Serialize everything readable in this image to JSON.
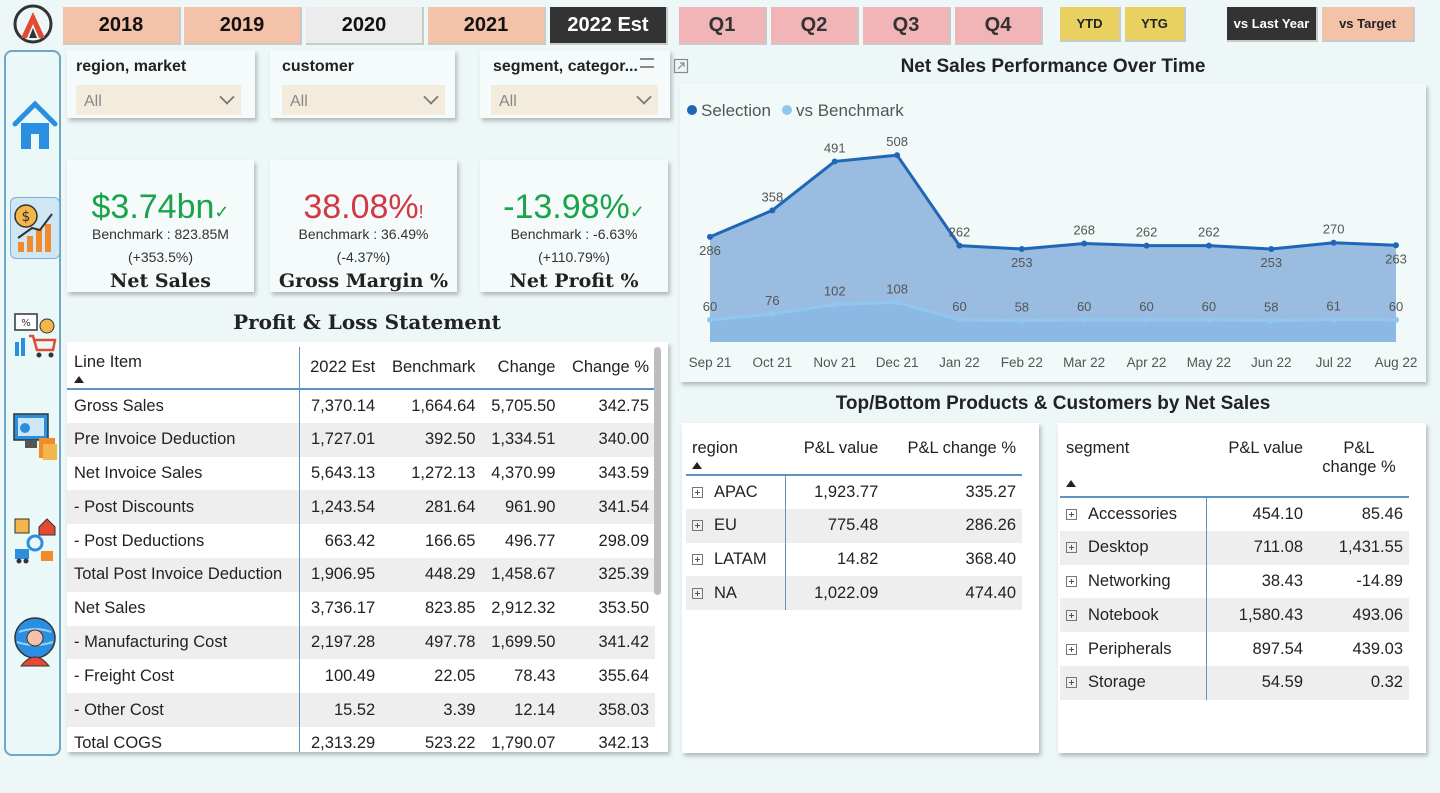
{
  "years": [
    "2018",
    "2019",
    "2020",
    "2021",
    "2022 Est"
  ],
  "quarters": [
    "Q1",
    "Q2",
    "Q3",
    "Q4"
  ],
  "period": [
    "YTD",
    "YTG"
  ],
  "compare": [
    "vs Last Year",
    "vs Target"
  ],
  "filters": [
    {
      "title": "region, market",
      "value": "All"
    },
    {
      "title": "customer",
      "value": "All"
    },
    {
      "title": "segment, categor...",
      "value": "All"
    }
  ],
  "kpis": [
    {
      "value": "$3.74bn",
      "mark": "✓",
      "benchmark": "Benchmark : 823.85M",
      "change": "(+353.5%)",
      "label": "Net Sales",
      "color": "#1aa34a"
    },
    {
      "value": "38.08%",
      "mark": "!",
      "benchmark": "Benchmark : 36.49%",
      "change": "(-4.37%)",
      "label": "Gross Margin %",
      "color": "#d13a45"
    },
    {
      "value": "-13.98%",
      "mark": "✓",
      "benchmark": "Benchmark : -6.63%",
      "change": "(+110.79%)",
      "label": "Net Profit %",
      "color": "#1aa34a"
    }
  ],
  "pl": {
    "title": "Profit & Loss Statement",
    "headers": [
      "Line Item",
      "2022 Est",
      "Benchmark",
      "Change",
      "Change %"
    ],
    "rows": [
      [
        "Gross Sales",
        "7,370.14",
        "1,664.64",
        "5,705.50",
        "342.75"
      ],
      [
        "Pre Invoice Deduction",
        "1,727.01",
        "392.50",
        "1,334.51",
        "340.00"
      ],
      [
        "Net Invoice Sales",
        "5,643.13",
        "1,272.13",
        "4,370.99",
        "343.59"
      ],
      [
        "- Post Discounts",
        "1,243.54",
        "281.64",
        "961.90",
        "341.54"
      ],
      [
        "- Post Deductions",
        "663.42",
        "166.65",
        "496.77",
        "298.09"
      ],
      [
        "Total Post Invoice Deduction",
        "1,906.95",
        "448.29",
        "1,458.67",
        "325.39"
      ],
      [
        "Net Sales",
        "3,736.17",
        "823.85",
        "2,912.32",
        "353.50"
      ],
      [
        "- Manufacturing Cost",
        "2,197.28",
        "497.78",
        "1,699.50",
        "341.42"
      ],
      [
        "- Freight Cost",
        "100.49",
        "22.05",
        "78.43",
        "355.64"
      ],
      [
        "- Other Cost",
        "15.52",
        "3.39",
        "12.14",
        "358.03"
      ],
      [
        "Total COGS",
        "2,313.29",
        "523.22",
        "1,790.07",
        "342.13"
      ]
    ]
  },
  "chart_data": {
    "type": "area",
    "title": "Net Sales Performance Over Time",
    "categories": [
      "Sep 21",
      "Oct 21",
      "Nov 21",
      "Dec 21",
      "Jan 22",
      "Feb 22",
      "Mar 22",
      "Apr 22",
      "May 22",
      "Jun 22",
      "Jul 22",
      "Aug 22"
    ],
    "series": [
      {
        "name": "Selection",
        "values": [
          286,
          358,
          491,
          508,
          262,
          253,
          268,
          262,
          262,
          253,
          270,
          263
        ],
        "color": "#1f67b6"
      },
      {
        "name": "vs Benchmark",
        "values": [
          60,
          76,
          102,
          108,
          60,
          58,
          60,
          60,
          60,
          58,
          61,
          60
        ],
        "color": "#90c7f0"
      }
    ],
    "ylim": [
      0,
      620
    ],
    "grid": false,
    "legend": "top-left"
  },
  "topbottom": {
    "title": "Top/Bottom Products & Customers by Net Sales",
    "region": {
      "headers": [
        "region",
        "P&L value",
        "P&L change %"
      ],
      "rows": [
        [
          "APAC",
          "1,923.77",
          "335.27"
        ],
        [
          "EU",
          "775.48",
          "286.26"
        ],
        [
          "LATAM",
          "14.82",
          "368.40"
        ],
        [
          "NA",
          "1,022.09",
          "474.40"
        ]
      ]
    },
    "segment": {
      "headers": [
        "segment",
        "P&L value",
        "P&L change %"
      ],
      "rows": [
        [
          "Accessories",
          "454.10",
          "85.46"
        ],
        [
          "Desktop",
          "711.08",
          "1,431.55"
        ],
        [
          "Networking",
          "38.43",
          "-14.89"
        ],
        [
          "Notebook",
          "1,580.43",
          "493.06"
        ],
        [
          "Peripherals",
          "897.54",
          "439.03"
        ],
        [
          "Storage",
          "54.59",
          "0.32"
        ]
      ]
    }
  },
  "nav": [
    "home-icon",
    "finance-icon",
    "sales-icon",
    "marketing-icon",
    "supply-chain-icon",
    "executive-icon"
  ]
}
